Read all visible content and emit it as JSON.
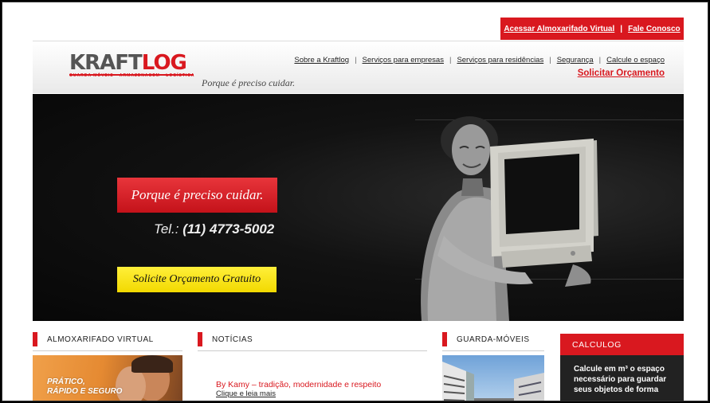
{
  "topbar": {
    "almox_link": "Acessar Almoxarifado Virtual",
    "separator": "|",
    "contact_link": "Fale Conosco"
  },
  "logo": {
    "word_part1": "KRAFT",
    "word_part2": "LOG",
    "sub": "GUARDA MÓVEIS · ARMAZENAGEM · LOGÍSTICA",
    "tagline": "Porque é preciso cuidar."
  },
  "nav": {
    "items": [
      "Sobre a Kraftlog",
      "Serviços para empresas",
      "Serviços para residências",
      "Segurança",
      "Calcule o espaço"
    ],
    "separator": "|",
    "quote": "Solicitar Orçamento"
  },
  "hero": {
    "badge": "Porque é preciso cuidar.",
    "tel_prefix": "Tel.:",
    "tel_number": "(11) 4773-5002",
    "cta": "Solicite Orçamento Gratuito"
  },
  "columns": {
    "almox": {
      "title": "ALMOXARIFADO VIRTUAL",
      "image_line1": "PRÁTICO,",
      "image_line2": "RÁPIDO E SEGURO"
    },
    "news": {
      "title": "NOTÍCIAS",
      "item_title": "By Kamy – tradição, modernidade e respeito",
      "item_link": "Clique e leia mais"
    },
    "guarda": {
      "title": "GUARDA-MÓVEIS"
    },
    "calc": {
      "title": "CALCULOG",
      "text_line1": "Calcule em m³ o espaço",
      "text_line2": "necessário para guardar",
      "text_line3": "seus objetos de forma"
    }
  },
  "colors": {
    "brand_red": "#d9181f",
    "cta_yellow": "#f5e11a",
    "hero_bg": "#0b0b0b"
  }
}
